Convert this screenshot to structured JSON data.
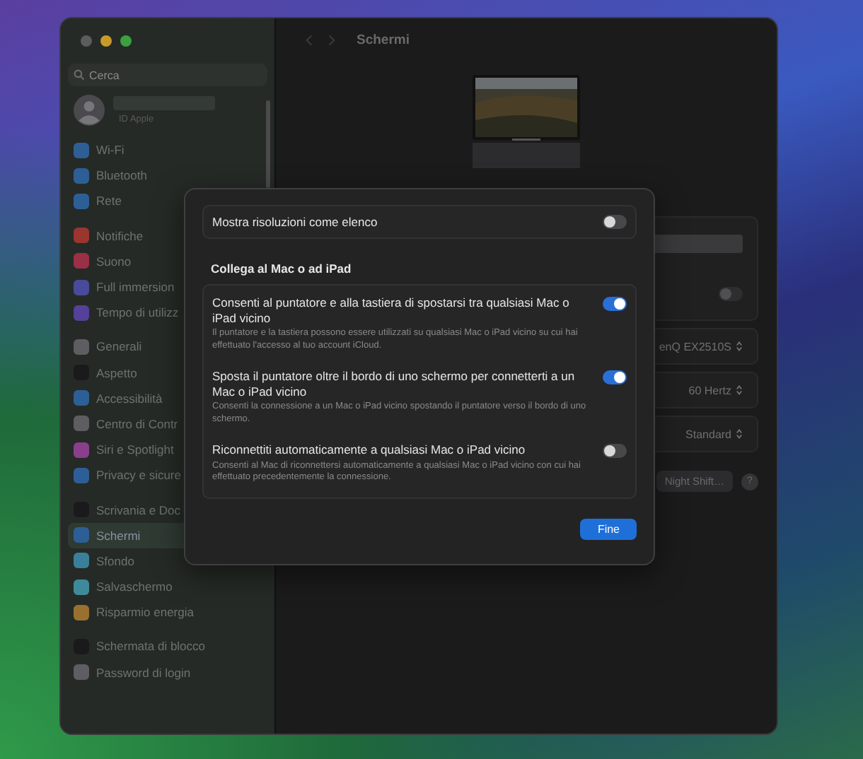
{
  "window": {
    "title": "Schermi"
  },
  "sidebar": {
    "search": {
      "placeholder": "Cerca"
    },
    "account": {
      "label": "ID Apple"
    },
    "groups": [
      [
        {
          "label": "Wi-Fi",
          "color": "#2d5f96",
          "selected": false
        },
        {
          "label": "Bluetooth",
          "color": "#2d5f96",
          "selected": false
        },
        {
          "label": "Rete",
          "color": "#2d5f96",
          "selected": false
        }
      ],
      [
        {
          "label": "Notifiche",
          "color": "#9a3530",
          "selected": false
        },
        {
          "label": "Suono",
          "color": "#9a3045",
          "selected": false
        },
        {
          "label": "Full immersion",
          "color": "#4a4a9a",
          "selected": false
        },
        {
          "label": "Tempo di utilizz",
          "color": "#55409a",
          "selected": false
        }
      ],
      [
        {
          "label": "Generali",
          "color": "#5e5e62",
          "selected": false
        },
        {
          "label": "Aspetto",
          "color": "#1a1a1c",
          "selected": false
        },
        {
          "label": "Accessibilità",
          "color": "#2d5f96",
          "selected": false
        },
        {
          "label": "Centro di Contr",
          "color": "#5e5e62",
          "selected": false
        },
        {
          "label": "Siri e Spotlight",
          "color": "#8a3f8a",
          "selected": false
        },
        {
          "label": "Privacy e sicure",
          "color": "#2d5f96",
          "selected": false
        }
      ],
      [
        {
          "label": "Scrivania e Doc",
          "color": "#1a1a1c",
          "selected": false
        },
        {
          "label": "Schermi",
          "color": "#2d5f96",
          "selected": true
        },
        {
          "label": "Sfondo",
          "color": "#3a7f9a",
          "selected": false
        },
        {
          "label": "Salvaschermo",
          "color": "#3f8a9a",
          "selected": false
        },
        {
          "label": "Risparmio energia",
          "color": "#9a7030",
          "selected": false
        }
      ],
      [
        {
          "label": "Schermata di blocco",
          "color": "#1a1a1c",
          "selected": false
        },
        {
          "label": "Password di login",
          "color": "#5e5e62",
          "selected": false
        }
      ]
    ]
  },
  "main": {
    "groups": [
      [
        {
          "kind": "bar"
        },
        {
          "kind": "toggle",
          "on": false
        }
      ],
      [
        {
          "kind": "select",
          "value": "enQ EX2510S"
        }
      ],
      [
        {
          "kind": "select",
          "value": "60 Hertz"
        }
      ],
      [
        {
          "kind": "select",
          "value": "Standard"
        }
      ]
    ],
    "night_shift_button": "Night Shift…",
    "help_button": "?"
  },
  "dialog": {
    "toggle_row": {
      "label": "Mostra risoluzioni come elenco",
      "on": false
    },
    "section_title": "Collega al Mac o ad iPad",
    "items": [
      {
        "title": "Consenti al puntatore e alla tastiera di spostarsi tra qualsiasi Mac o iPad vicino",
        "description": "Il puntatore e la tastiera possono essere utilizzati su qualsiasi Mac o iPad vicino su cui hai effettuato l'accesso al tuo account iCloud.",
        "on": true
      },
      {
        "title": "Sposta il puntatore oltre il bordo di uno schermo per connetterti a un Mac o iPad vicino",
        "description": "Consenti la connessione a un Mac o iPad vicino spostando il puntatore verso il bordo di uno schermo.",
        "on": true
      },
      {
        "title": "Riconnettiti automaticamente a qualsiasi Mac o iPad vicino",
        "description": "Consenti al Mac di riconnettersi automaticamente a qualsiasi Mac o iPad vicino con cui hai effettuato precedentemente la connessione.",
        "on": false
      }
    ],
    "done_button": "Fine"
  }
}
